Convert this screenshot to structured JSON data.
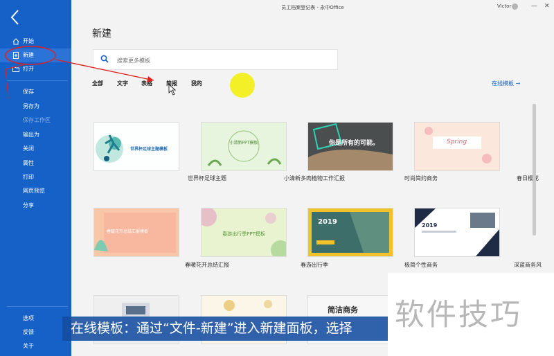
{
  "window": {
    "title": "员工档案登记表 - 永中Office",
    "user": "Victor",
    "minimize": "—",
    "close": "✕"
  },
  "sidebar": {
    "items": [
      {
        "label": "开始"
      },
      {
        "label": "新建"
      },
      {
        "label": "打开"
      },
      {
        "label": "保存"
      },
      {
        "label": "另存为"
      },
      {
        "label": "保存工作区"
      },
      {
        "label": "输出为"
      },
      {
        "label": "关闭"
      },
      {
        "label": "属性"
      },
      {
        "label": "打印"
      },
      {
        "label": "网页预览"
      },
      {
        "label": "分享"
      },
      {
        "label": "选项"
      },
      {
        "label": "反馈"
      },
      {
        "label": "关于"
      }
    ]
  },
  "main": {
    "title": "新建",
    "search": {
      "placeholder": "搜索更多模板"
    },
    "tabs": [
      "全部",
      "文字",
      "表格",
      "简报",
      "我的"
    ],
    "online_link": "在线模板 →",
    "templates": [
      {
        "name": "世界杯足球主题",
        "thumb_text": "世界杯足球主题模板"
      },
      {
        "name": "小清新多肉植物工作汇报",
        "thumb_text": "小清新PPT模板"
      },
      {
        "name": "时尚简约商务",
        "thumb_text": "你是所有的可能。"
      },
      {
        "name": "春日樱花",
        "thumb_text": "Spring"
      },
      {
        "name": "春暖花开总结汇报",
        "thumb_text": "春暖花开总结汇报模板"
      },
      {
        "name": "春游出行季",
        "thumb_text": "春游出行季PPT模板"
      },
      {
        "name": "极简个性商务",
        "thumb_text": "2019"
      },
      {
        "name": "深蓝商务风",
        "thumb_text": "2019"
      },
      {
        "name": "",
        "thumb_text": ""
      },
      {
        "name": "",
        "thumb_text": ""
      },
      {
        "name": "",
        "thumb_text": "简洁商务"
      },
      {
        "name": "",
        "thumb_text": ""
      }
    ]
  },
  "overlay": {
    "banner": "在线模板：通过“文件-新建”进入新建面板，选择",
    "watermark": "软件技巧"
  },
  "colors": {
    "sidebar": "#1561c7",
    "accent": "#1561c7",
    "highlight": "#f2ef1c",
    "annotation": "#e02020"
  }
}
